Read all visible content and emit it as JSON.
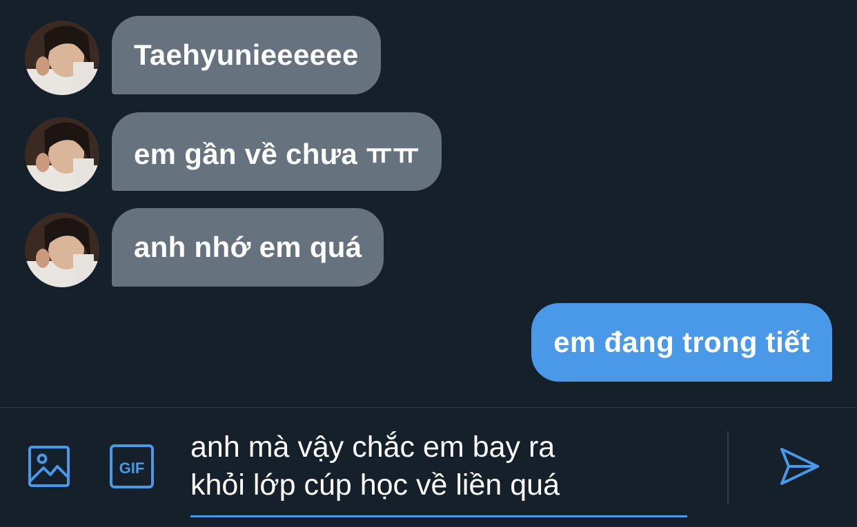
{
  "conversation": {
    "messages": [
      {
        "direction": "incoming",
        "text": "Taehyunieeeeee"
      },
      {
        "direction": "incoming",
        "text": "em gần về chưa ㅠㅠ"
      },
      {
        "direction": "incoming",
        "text": "anh nhớ em quá"
      },
      {
        "direction": "outgoing",
        "text": "em đang trong tiết"
      }
    ]
  },
  "composer": {
    "text": "anh mà vậy chắc em bay ra\nkhỏi lớp cúp học về liền quá",
    "icons": {
      "media": "image-icon",
      "gif": "gif-icon",
      "send": "send-icon"
    },
    "gif_label": "GIF"
  },
  "colors": {
    "background": "#15202b",
    "incoming_bubble": "#66737f",
    "outgoing_bubble": "#4a99e9",
    "accent": "#4a99e9"
  }
}
